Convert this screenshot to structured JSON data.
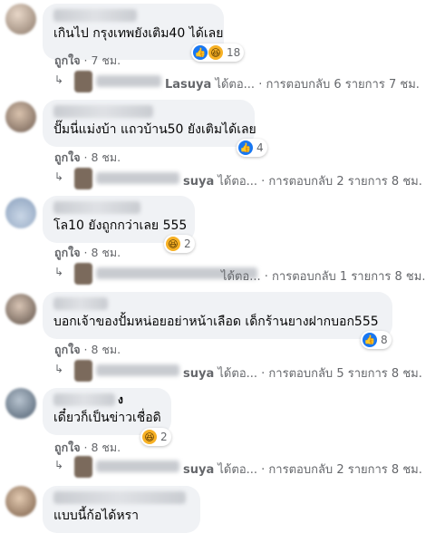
{
  "comments": [
    {
      "text": "เกินไป กรุงเทพยังเติม40 ได้เลย",
      "reaction_count": "18",
      "reaction_icons": [
        "like-icon",
        "haha-icon"
      ],
      "like_label": "ถูกใจ",
      "time": "7 ชม.",
      "reply": {
        "name_fragment": "Lasuya",
        "verb": "ได้ตอ...",
        "summary": "· การตอบกลับ 6 รายการ",
        "time": "7 ชม."
      }
    },
    {
      "text": "ปั๊มนี่แม่งบ้า แถวบ้าน50 ยังเติมได้เลย",
      "reaction_count": "4",
      "reaction_icons": [
        "like-icon"
      ],
      "like_label": "ถูกใจ",
      "time": "8 ชม.",
      "reply": {
        "name_fragment": "suya",
        "verb": "ได้ตอ...",
        "summary": "· การตอบกลับ 2 รายการ",
        "time": "8 ชม."
      }
    },
    {
      "text": "โล10 ยังถูกกว่าเลย 555",
      "reaction_count": "2",
      "reaction_icons": [
        "haha-icon"
      ],
      "like_label": "ถูกใจ",
      "time": "8 ชม.",
      "reply": {
        "name_fragment": "",
        "verb": "ได้ตอ...",
        "summary": "· การตอบกลับ 1 รายการ",
        "time": "8 ชม."
      }
    },
    {
      "text": "บอกเจ้าของปั้มหน่อยอย่าหน้าเลือด เด็กร้านยางฝากบอก555",
      "reaction_count": "8",
      "reaction_icons": [
        "like-icon"
      ],
      "like_label": "ถูกใจ",
      "time": "8 ชม.",
      "reply": {
        "name_fragment": "suya",
        "verb": "ได้ตอ...",
        "summary": "· การตอบกลับ 5 รายการ",
        "time": "8 ชม."
      }
    },
    {
      "author_fragment": "ง",
      "text": "เดี๋ยวก็เป็นข่าวเชื่อดิ",
      "reaction_count": "2",
      "reaction_icons": [
        "haha-icon"
      ],
      "like_label": "ถูกใจ",
      "time": "8 ชม.",
      "reply": {
        "name_fragment": "suya",
        "verb": "ได้ตอ...",
        "summary": "· การตอบกลับ 2 รายการ",
        "time": "8 ชม."
      }
    },
    {
      "text": "แบบนี้ก้อได้หรา"
    }
  ],
  "colors": {
    "bubble": "#f0f2f5",
    "like_blue": "#1877f2",
    "haha_yellow": "#f7b125",
    "meta_gray": "#65676b"
  }
}
